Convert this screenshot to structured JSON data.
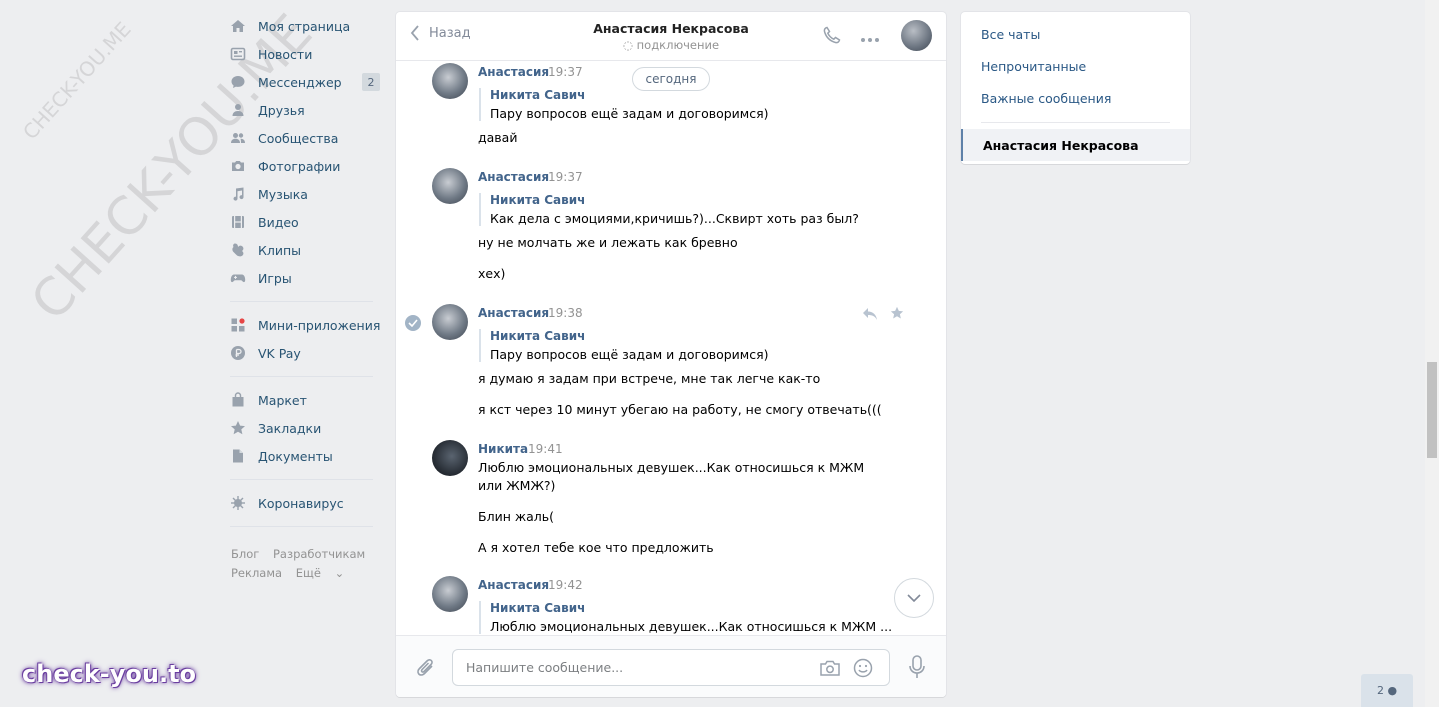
{
  "nav": {
    "items": [
      {
        "label": "Моя страница",
        "icon": "home-icon"
      },
      {
        "label": "Новости",
        "icon": "news-icon"
      },
      {
        "label": "Мессенджер",
        "icon": "messenger-icon",
        "badge": "2"
      },
      {
        "label": "Друзья",
        "icon": "friends-icon"
      },
      {
        "label": "Сообщества",
        "icon": "communities-icon"
      },
      {
        "label": "Фотографии",
        "icon": "camera-icon"
      },
      {
        "label": "Музыка",
        "icon": "music-icon"
      },
      {
        "label": "Видео",
        "icon": "video-icon"
      },
      {
        "label": "Клипы",
        "icon": "clips-icon"
      },
      {
        "label": "Игры",
        "icon": "gamepad-icon"
      }
    ],
    "apps": [
      {
        "label": "Мини-приложения",
        "icon": "apps-icon"
      },
      {
        "label": "VK Pay",
        "icon": "ruble-icon"
      }
    ],
    "extra": [
      {
        "label": "Маркет",
        "icon": "bag-icon"
      },
      {
        "label": "Закладки",
        "icon": "star-icon"
      },
      {
        "label": "Документы",
        "icon": "document-icon"
      }
    ],
    "covid": {
      "label": "Коронавирус",
      "icon": "virus-icon"
    },
    "footer": {
      "blog": "Блог",
      "devs": "Разработчикам",
      "ads": "Реклама",
      "more": "Ещё"
    }
  },
  "chat": {
    "back_label": "Назад",
    "peer_name": "Анастасия Некрасова",
    "peer_status": "подключение",
    "today_label": "сегодня",
    "composer_placeholder": "Напишите сообщение..."
  },
  "messages": [
    {
      "sender": "Анастасия",
      "time": "19:37",
      "fwd_name": "Никита Савич",
      "fwd_text": "Пару вопросов ещё задам и договоримся)",
      "lines": [
        "давай"
      ]
    },
    {
      "sender": "Анастасия",
      "time": "19:37",
      "fwd_name": "Никита Савич",
      "fwd_text": "Как дела с эмоциями,кричишь?)...Сквирт хоть раз был?",
      "lines": [
        "ну не молчать же и лежать как бревно",
        "хех)"
      ]
    },
    {
      "sender": "Анастасия",
      "time": "19:38",
      "fwd_name": "Никита Савич",
      "fwd_text": "Пару вопросов ещё задам и договоримся)",
      "lines": [
        "я думаю я задам при встрече, мне так легче как-то",
        "я кст через 10 минут убегаю на работу, не смогу отвечать((("
      ]
    },
    {
      "sender": "Никита",
      "time": "19:41",
      "lines": [
        "Люблю эмоциональных девушек...Как относишься к МЖМ",
        "или ЖМЖ?)",
        "Блин жаль(",
        "А я хотел тебе кое что предложить"
      ]
    },
    {
      "sender": "Анастасия",
      "time": "19:42",
      "fwd_name": "Никита Савич",
      "fwd_text": "Люблю эмоциональных девушек...Как относишься к МЖМ ..."
    }
  ],
  "right_panel": {
    "all_chats": "Все чаты",
    "unread": "Непрочитанные",
    "important": "Важные сообщения",
    "active_chat": "Анастасия Некрасова"
  },
  "online_count": "2",
  "watermarks": {
    "diagonal_big": "CHECK-YOU.ME",
    "diagonal_small": "CHECK-YOU.ME",
    "brand": "check-you.to"
  },
  "colors": {
    "link": "#2a5885",
    "accent": "#42648b",
    "background": "#edeef0"
  }
}
